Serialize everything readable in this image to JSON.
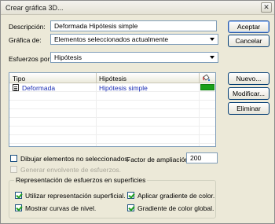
{
  "window": {
    "title": "Crear gráfica 3D...",
    "close_glyph": "✕"
  },
  "form": {
    "descripcion": {
      "label": "Descripción:",
      "value": "Deformada Hipótesis simple"
    },
    "grafica_de": {
      "label": "Gráfica de:",
      "selected": "Elementos seleccionados actualmente"
    },
    "esfuerzos_por": {
      "label": "Esfuerzos por:",
      "selected": "Hipótesis"
    }
  },
  "buttons": {
    "aceptar": "Aceptar",
    "cancelar": "Cancelar",
    "nuevo": "Nuevo...",
    "modificar": "Modificar...",
    "eliminar": "Eliminar"
  },
  "table": {
    "columns": [
      "Tipo",
      "Hipótesis"
    ],
    "color_column_icon": "paint-bucket-icon",
    "rows": [
      {
        "tipo": "Deformada",
        "hipotesis": "Hipótesis simple",
        "color": "#1aa01a"
      }
    ]
  },
  "options": {
    "dibujar_no_seleccionados": {
      "label": "Dibujar elementos no seleccionados.",
      "checked": false
    },
    "generar_envolvente": {
      "label": "Generar envolvente de esfuerzos.",
      "checked": false,
      "enabled": false
    },
    "factor_ampliacion": {
      "label": "Factor de ampliación",
      "value": "200"
    }
  },
  "superficies": {
    "title": "Representación de esfuerzos en superficies",
    "items": [
      {
        "label": "Utilizar representación superficial.",
        "checked": true
      },
      {
        "label": "Aplicar gradiente de color.",
        "checked": true
      },
      {
        "label": "Mostrar curvas de nivel.",
        "checked": true
      },
      {
        "label": "Gradiente de color global.",
        "checked": true
      }
    ]
  }
}
